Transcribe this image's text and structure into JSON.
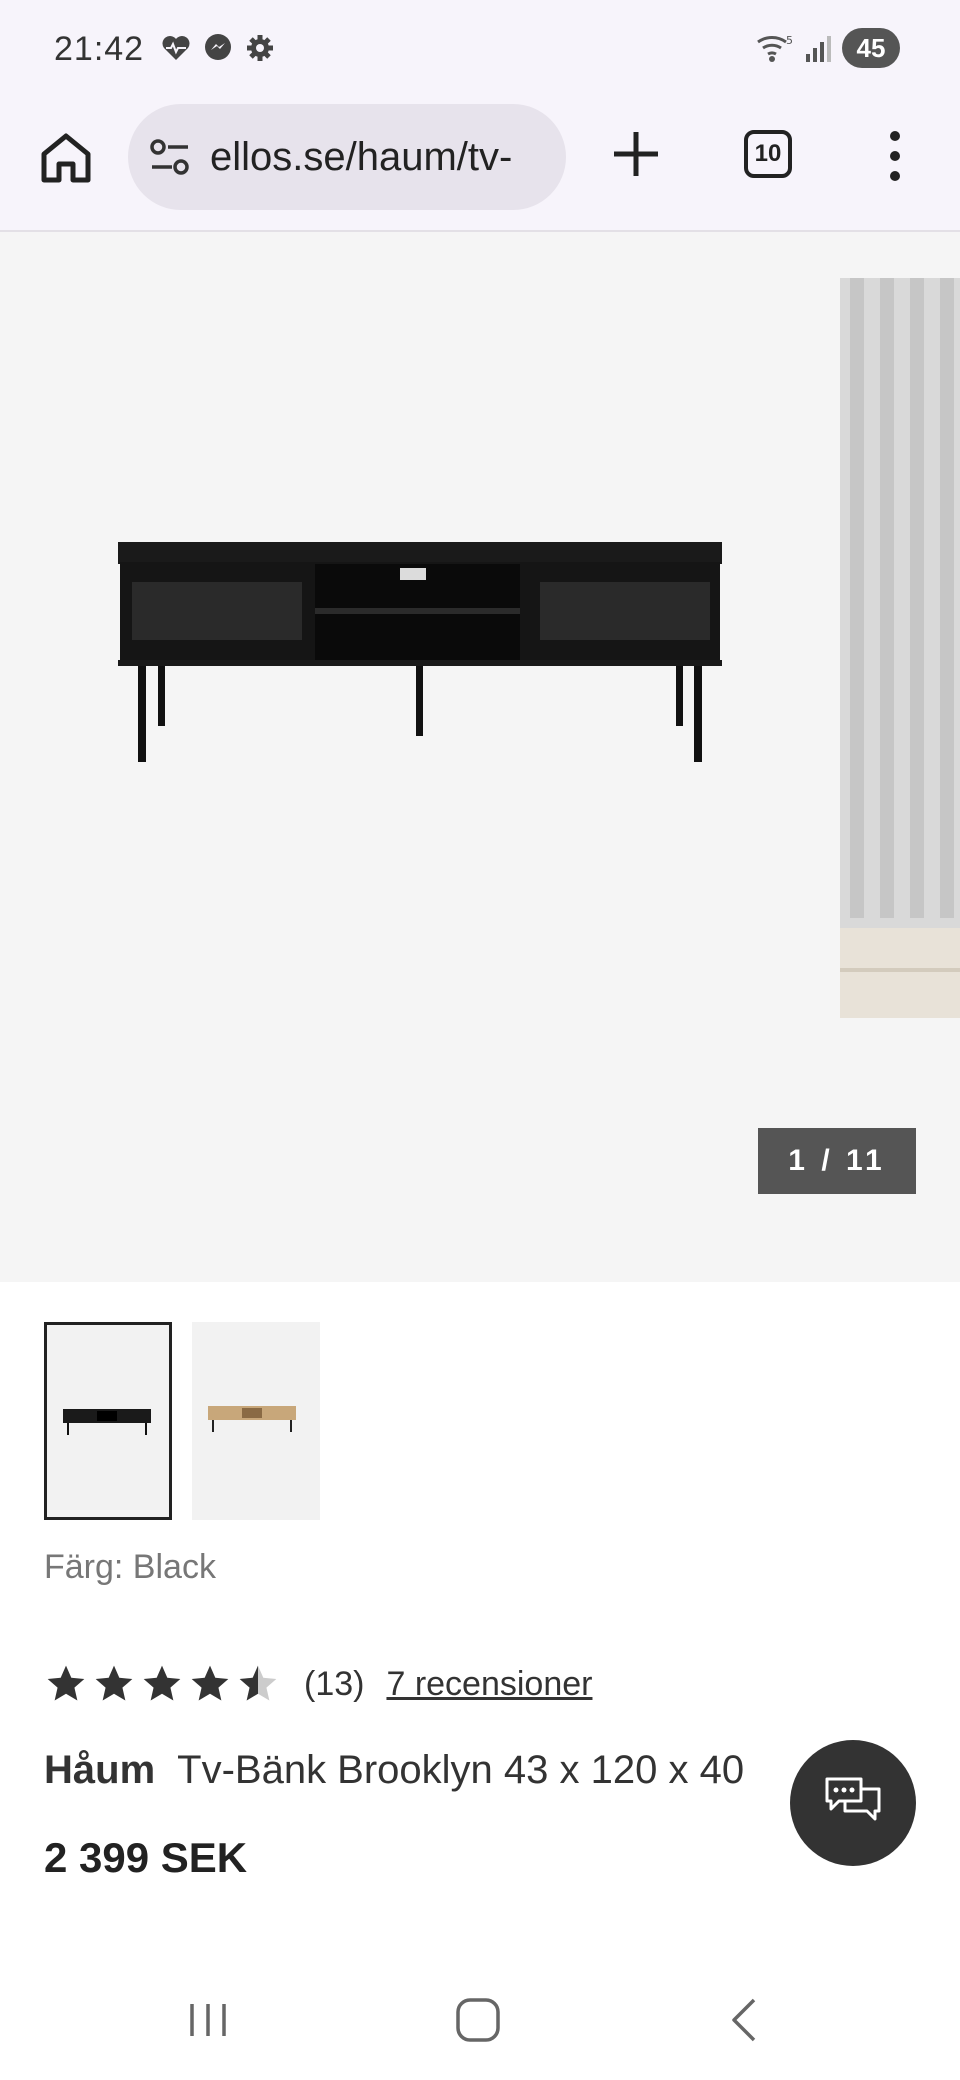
{
  "status_bar": {
    "time": "21:42",
    "battery": "45",
    "left_icons": [
      "heart-pulse-icon",
      "messenger-icon",
      "gear-icon"
    ],
    "right_icons": [
      "wifi-icon",
      "signal-icon",
      "battery-icon"
    ]
  },
  "browser": {
    "url": "ellos.se/haum/tv-",
    "tab_count": "10"
  },
  "gallery": {
    "counter": "1 / 11"
  },
  "product": {
    "color_label": "Färg: Black",
    "rating_value": 4.5,
    "rating_max": 5,
    "rating_count": "(13)",
    "reviews_link": "7 recensioner",
    "brand": "Håum",
    "name": "Tv-Bänk Brooklyn 43 x 120 x 40",
    "price": "2 399 SEK"
  },
  "colors": {
    "accent_dark": "#333333",
    "counter_bg": "#555555"
  }
}
